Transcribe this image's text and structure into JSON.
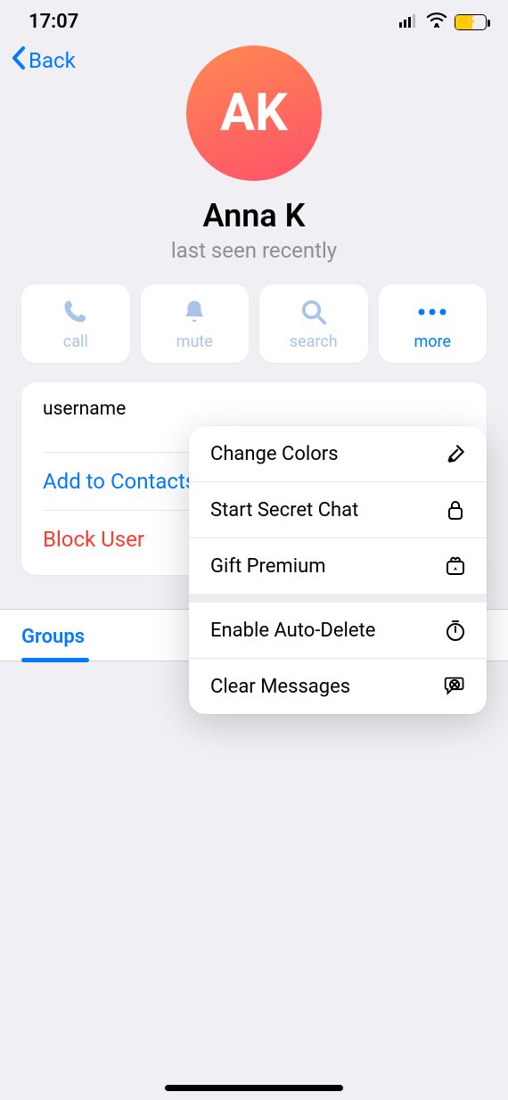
{
  "status_bar": {
    "time": "17:07"
  },
  "nav": {
    "back": "Back"
  },
  "profile": {
    "initials": "AK",
    "name": "Anna K",
    "status": "last seen recently"
  },
  "actions": {
    "call": "call",
    "mute": "mute",
    "search": "search",
    "more": "more"
  },
  "info": {
    "username_label": "username",
    "add_to_contacts": "Add to Contacts",
    "block_user": "Block User"
  },
  "tabs": {
    "groups": "Groups"
  },
  "popover": {
    "change_colors": "Change Colors",
    "start_secret_chat": "Start Secret Chat",
    "gift_premium": "Gift Premium",
    "enable_auto_delete": "Enable Auto-Delete",
    "clear_messages": "Clear Messages"
  }
}
